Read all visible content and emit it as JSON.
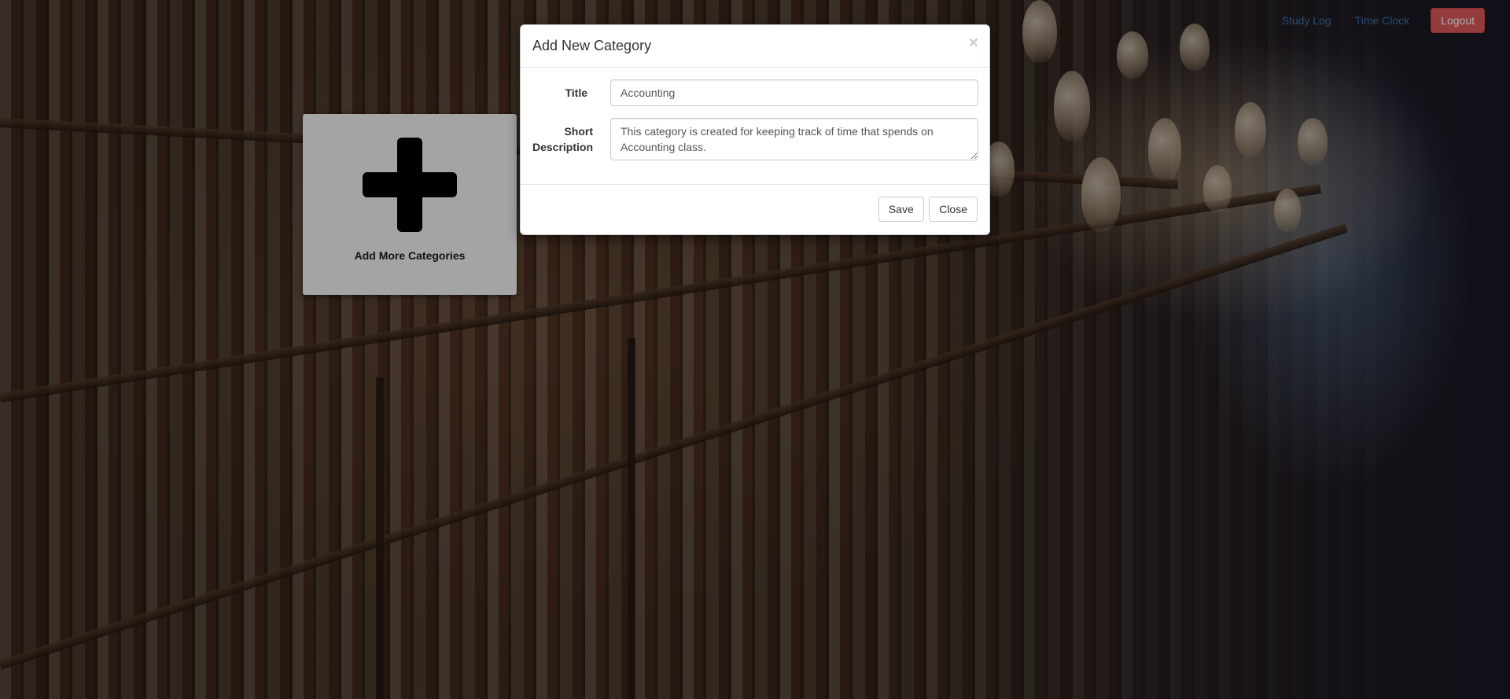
{
  "navbar": {
    "links": [
      {
        "label": "Study Log"
      },
      {
        "label": "Time Clock"
      }
    ],
    "logout_label": "Logout",
    "logout_color": "#d9534f",
    "link_color": "#337ab7"
  },
  "add_card": {
    "icon": "plus-icon",
    "label": "Add More Categories"
  },
  "modal": {
    "title": "Add New Category",
    "close_icon": "×",
    "fields": {
      "title": {
        "label": "Title",
        "value": "Accounting"
      },
      "description": {
        "label_line1": "Short",
        "label_line2": "Description",
        "value": "This category is created for keeping track of time that spends on Accounting class."
      }
    },
    "buttons": {
      "save": "Save",
      "close": "Close"
    }
  }
}
